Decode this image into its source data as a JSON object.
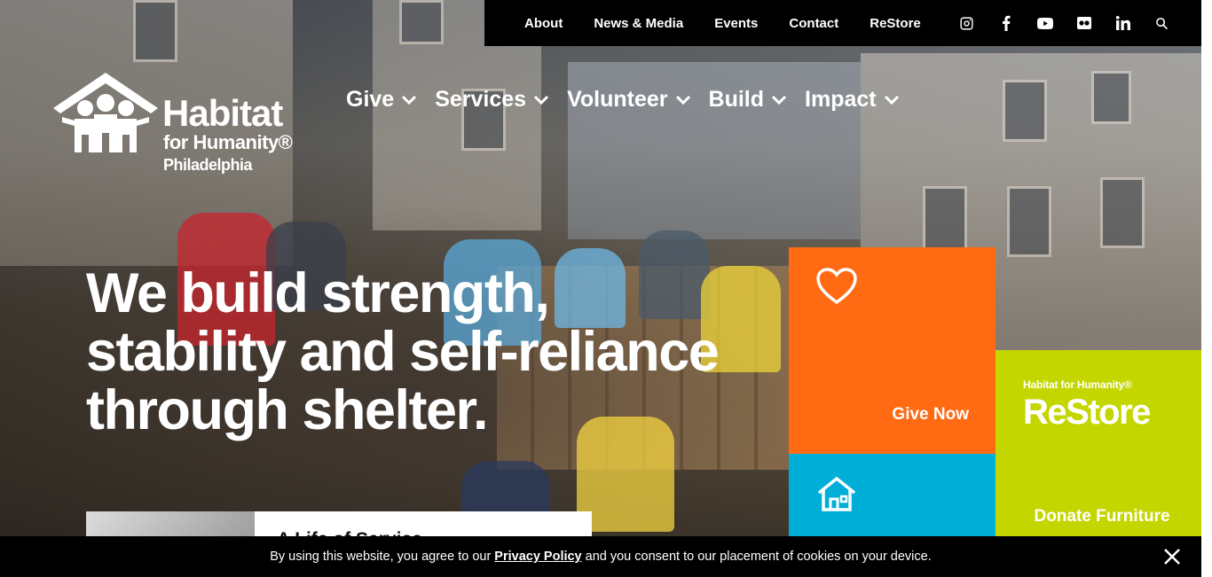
{
  "topbar": {
    "links": [
      "About",
      "News & Media",
      "Events",
      "Contact",
      "ReStore"
    ],
    "social_icons": [
      "instagram-icon",
      "facebook-icon",
      "youtube-icon",
      "flickr-icon",
      "linkedin-icon",
      "search-icon"
    ]
  },
  "logo": {
    "line1": "Habitat",
    "line2": "for Humanity®",
    "line3": "Philadelphia"
  },
  "nav": {
    "items": [
      "Give",
      "Services",
      "Volunteer",
      "Build",
      "Impact"
    ]
  },
  "hero": {
    "headline_1": "We build strength,",
    "headline_2": "stability and self-reliance",
    "headline_3": "through shelter."
  },
  "tiles": {
    "give": {
      "label": "Give Now",
      "icon": "heart-icon",
      "color": "#ff6a13"
    },
    "home": {
      "icon": "house-icon",
      "color": "#00afd7"
    },
    "restore": {
      "brand_small": "Habitat for Humanity®",
      "brand_big": "ReStore",
      "label": "Donate Furniture",
      "color": "#c4d600"
    }
  },
  "story_card": {
    "title": "A Life of Service"
  },
  "cookie": {
    "text_before": "By using this website, you agree to our",
    "link": "Privacy Policy",
    "text_after": "and you consent to our placement of cookies on your device."
  }
}
